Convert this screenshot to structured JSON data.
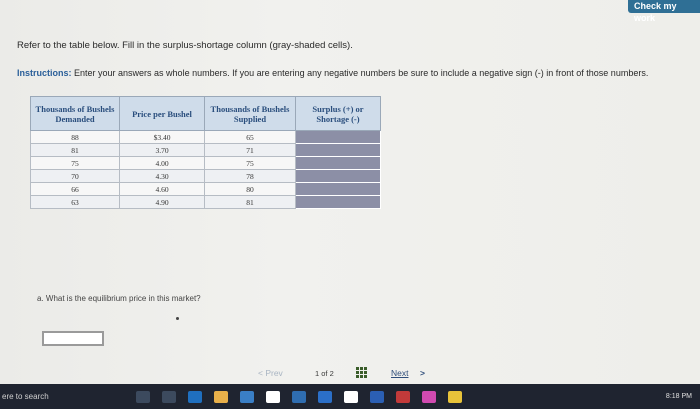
{
  "header": {
    "check_label": "Check my work"
  },
  "intro": "Refer to the table below. Fill in the surplus-shortage column (gray-shaded cells).",
  "instructions": {
    "label": "Instructions:",
    "text": " Enter your answers as whole numbers. If you are entering any negative numbers be sure to include a negative sign (-) in front of those numbers."
  },
  "table": {
    "headers": [
      "Thousands of Bushels Demanded",
      "Price per Bushel",
      "Thousands of Bushels Supplied",
      "Surplus (+) or Shortage (-)"
    ],
    "rows": [
      {
        "demanded": "88",
        "price": "$3.40",
        "supplied": "65"
      },
      {
        "demanded": "81",
        "price": "3.70",
        "supplied": "71"
      },
      {
        "demanded": "75",
        "price": "4.00",
        "supplied": "75"
      },
      {
        "demanded": "70",
        "price": "4.30",
        "supplied": "78"
      },
      {
        "demanded": "66",
        "price": "4.60",
        "supplied": "80"
      },
      {
        "demanded": "63",
        "price": "4.90",
        "supplied": "81"
      }
    ]
  },
  "question": "a. What is the equilibrium price in this market?",
  "pager": {
    "prev": "< Prev",
    "page": "1",
    "of": "of",
    "total": "2",
    "next": "Next",
    "next_arrow": ">"
  },
  "taskbar": {
    "search": "ere to search",
    "time": "8:18 PM"
  }
}
